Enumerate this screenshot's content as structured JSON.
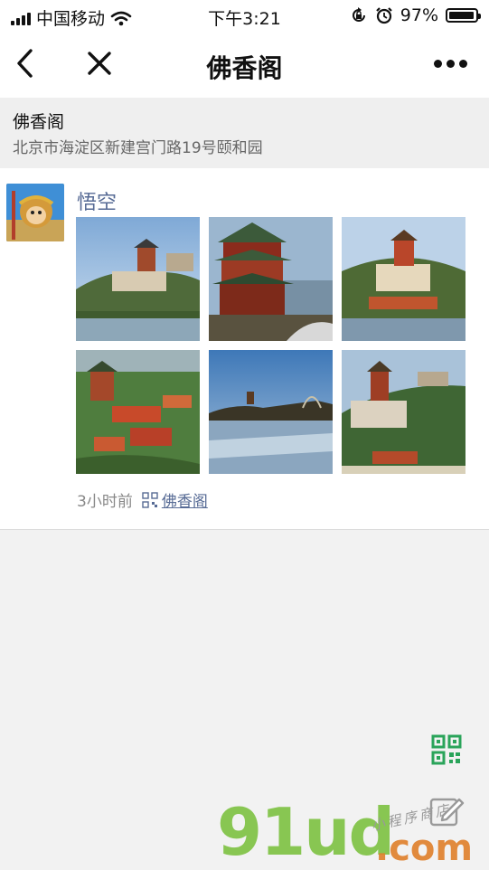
{
  "status_bar": {
    "carrier": "中国移动",
    "time": "下午3:21",
    "battery_percent": "97%",
    "battery_level": 0.97,
    "icons": [
      "signal-icon",
      "wifi-icon",
      "rotation-lock-icon",
      "alarm-icon",
      "battery-icon"
    ]
  },
  "nav": {
    "title": "佛香阁",
    "icons": [
      "back-arrow-icon",
      "close-icon",
      "more-icon"
    ]
  },
  "location": {
    "name": "佛香阁",
    "address": "北京市海淀区新建宫门路19号颐和园"
  },
  "post": {
    "author": "悟空",
    "time_ago": "3小时前",
    "place_link": "佛香阁",
    "photos": [
      "photo-tower-lakeside",
      "photo-pavilion-closeup",
      "photo-hill-complex",
      "photo-aerial-view",
      "photo-frozen-lake",
      "photo-hill-tower"
    ]
  },
  "watermark": {
    "brand": "91ud",
    "suffix": ".com",
    "tagline": "小程序商店"
  },
  "colors": {
    "link": "#576b95",
    "qr_green": "#2aa45a",
    "background": "#f2f2f2"
  }
}
